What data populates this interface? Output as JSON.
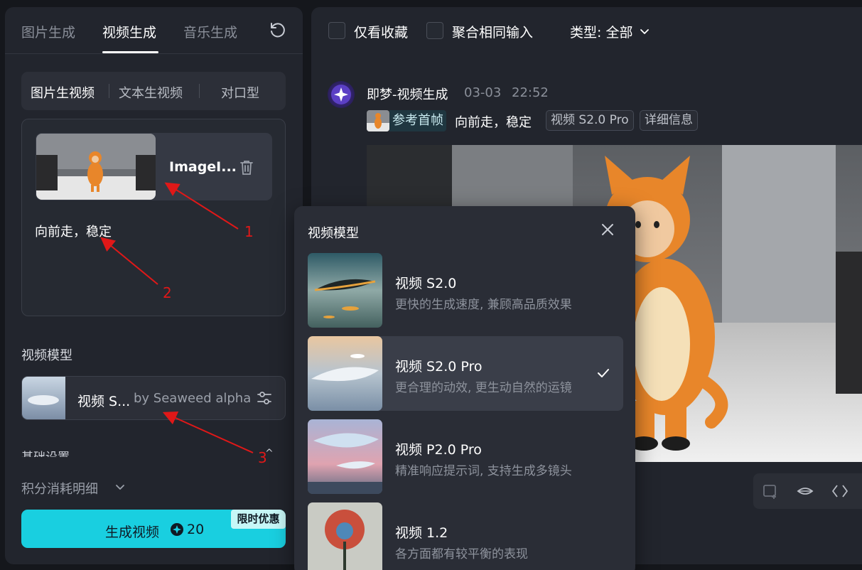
{
  "left_panel": {
    "tabs": [
      {
        "label": "图片生成"
      },
      {
        "label": "视频生成"
      },
      {
        "label": "音乐生成"
      }
    ],
    "mode_tabs": [
      {
        "label": "图片生视频"
      },
      {
        "label": "文本生视频"
      },
      {
        "label": "对口型"
      }
    ],
    "upload": {
      "file_name": "ImageI...",
      "prompt": "向前走，稳定"
    },
    "model_section": {
      "title": "视频模型",
      "selected_name": "视频 S...",
      "selected_by": "by Seaweed alpha"
    },
    "basic_settings_label": "基础设置",
    "credits_label": "积分消耗明细",
    "generate_button": {
      "label": "生成视频",
      "cost": "20",
      "promo_badge": "限时优惠"
    }
  },
  "right_panel": {
    "filters": {
      "favorites_only": "仅看收藏",
      "merge_same": "聚合相同输入",
      "type_label": "类型: 全部"
    },
    "message": {
      "title": "即梦-视频生成",
      "date": "03-03",
      "time": "22:52",
      "ref_tag": "参考首帧",
      "prompt": "向前走，稳定",
      "model_pill": "视频 S2.0 Pro",
      "details_pill": "详细信息"
    }
  },
  "popup": {
    "title": "视频模型",
    "options": [
      {
        "name": "视频 S2.0",
        "desc": "更快的生成速度, 兼顾高品质效果",
        "selected": false
      },
      {
        "name": "视频 S2.0 Pro",
        "desc": "更合理的动效, 更生动自然的运镜",
        "selected": true
      },
      {
        "name": "视频 P2.0 Pro",
        "desc": "精准响应提示词, 支持生成多镜头",
        "selected": false
      },
      {
        "name": "视频 1.2",
        "desc": "各方面都有较平衡的表现",
        "selected": false
      }
    ]
  },
  "annotations": [
    "1",
    "2",
    "3"
  ],
  "colors": {
    "accent": "#19cfe0",
    "panel": "#22252d",
    "annotation": "#e01818"
  }
}
